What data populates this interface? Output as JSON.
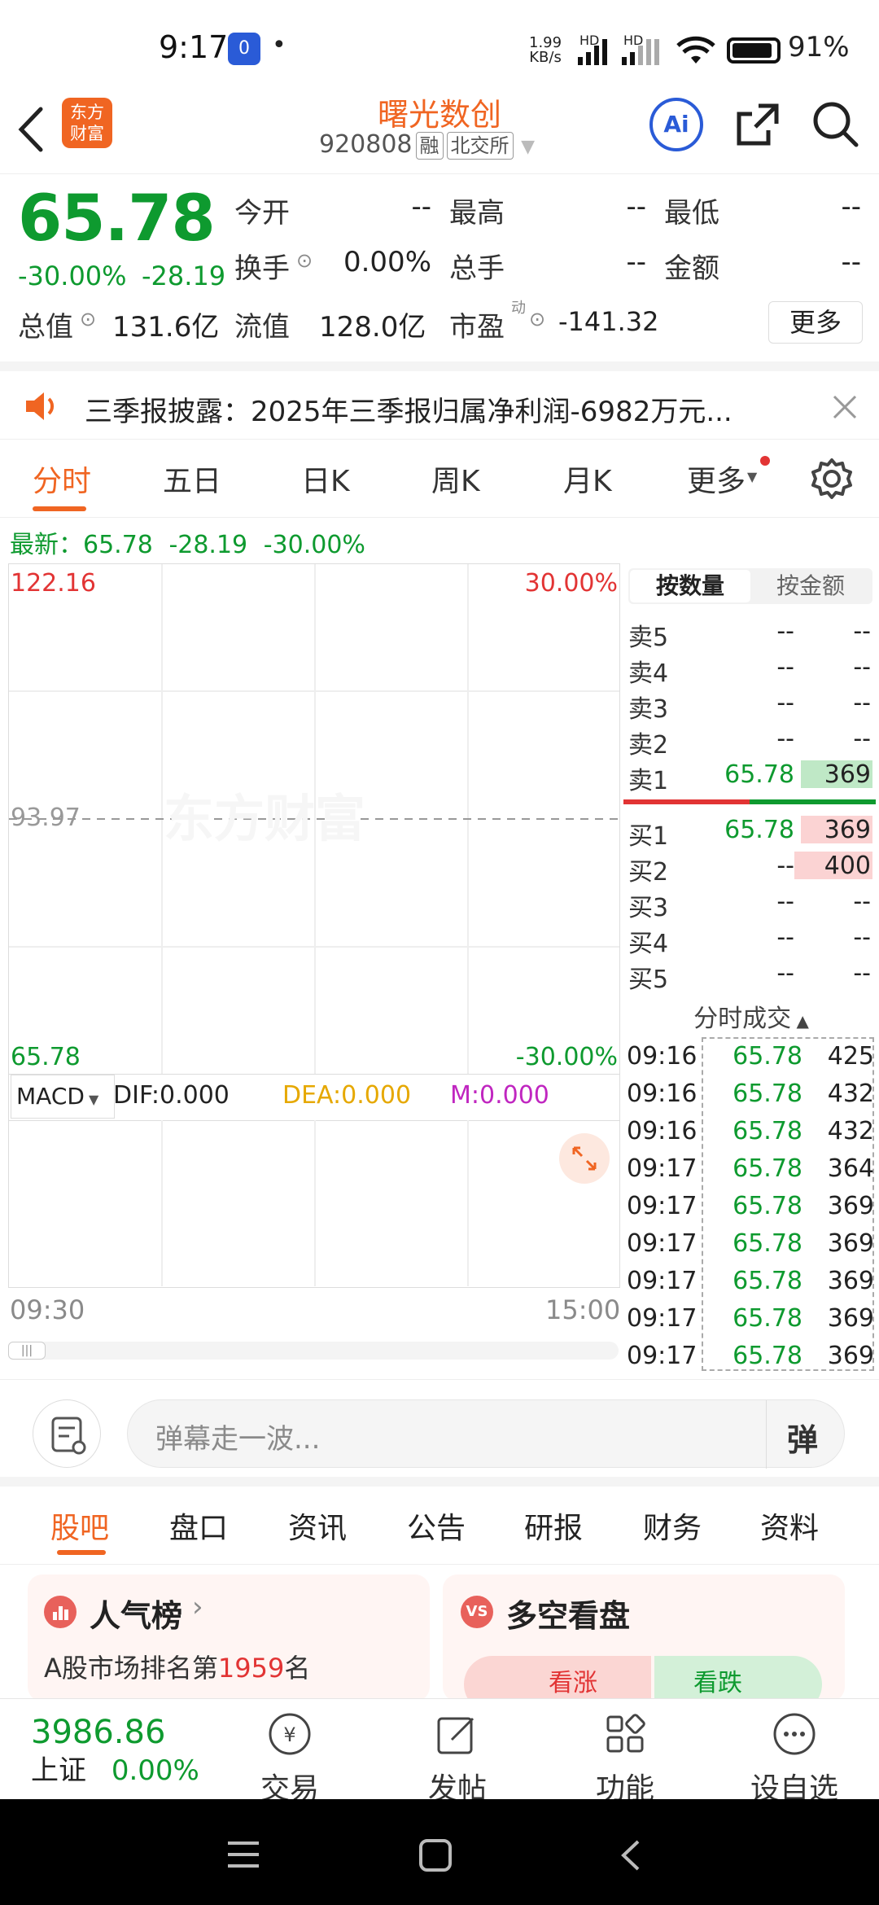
{
  "status_bar": {
    "time": "9:17",
    "app_badge": "0",
    "dot": "•",
    "net_speed": "1.99",
    "net_unit": "KB/s",
    "hd1": "HD",
    "hd2": "HD",
    "battery": "91%"
  },
  "header": {
    "logo_line1": "东方",
    "logo_line2": "财富",
    "stock_name": "曙光数创",
    "code": "920808",
    "tag_margin": "融",
    "tag_exchange": "北交所",
    "ai_label": "Ai"
  },
  "quote": {
    "price": "65.78",
    "change_pct": "-30.00%",
    "change": "-28.19",
    "open_label": "今开",
    "open": "--",
    "high_label": "最高",
    "high": "--",
    "low_label": "最低",
    "low": "--",
    "turnover_label": "换手",
    "turnover": "0.00%",
    "vol_label": "总手",
    "vol": "--",
    "amount_label": "金额",
    "amount": "--",
    "mcap_label": "总值",
    "mcap": "131.6亿",
    "float_label": "流值",
    "float": "128.0亿",
    "pe_label": "市盈",
    "pe_sup": "动",
    "pe": "-141.32",
    "more_button": "更多"
  },
  "notice": {
    "text": "三季报披露：2025年三季报归属净利润-6982万元..."
  },
  "tabs": [
    "分时",
    "五日",
    "日K",
    "周K",
    "月K",
    "更多"
  ],
  "latest_line": {
    "label": "最新：",
    "price": "65.78",
    "change": "-28.19",
    "pct": "-30.00%"
  },
  "chart": {
    "y_top": "122.16",
    "y_mid": "93.97",
    "y_bottom": "65.78",
    "pct_top": "30.00%",
    "pct_bottom": "-30.00%",
    "watermark": "东方财富",
    "x_start": "09:30",
    "x_end": "15:00",
    "macd_selector": "MACD",
    "dif": "DIF:0.000",
    "dea": "DEA:0.000",
    "m": "M:0.000",
    "accent_red": "#e23434",
    "accent_green": "#0e9a2f"
  },
  "order_book": {
    "toggle_qty": "按数量",
    "toggle_amt": "按金额",
    "sells": [
      {
        "label": "卖5",
        "price": "--",
        "vol": "--"
      },
      {
        "label": "卖4",
        "price": "--",
        "vol": "--"
      },
      {
        "label": "卖3",
        "price": "--",
        "vol": "--"
      },
      {
        "label": "卖2",
        "price": "--",
        "vol": "--"
      },
      {
        "label": "卖1",
        "price": "65.78",
        "vol": "369"
      }
    ],
    "buys": [
      {
        "label": "买1",
        "price": "65.78",
        "vol": "369"
      },
      {
        "label": "买2",
        "price": "--",
        "vol": "400"
      },
      {
        "label": "买3",
        "price": "--",
        "vol": "--"
      },
      {
        "label": "买4",
        "price": "--",
        "vol": "--"
      },
      {
        "label": "买5",
        "price": "--",
        "vol": "--"
      }
    ],
    "ticks_title": "分时成交",
    "ticks": [
      {
        "time": "09:16",
        "price": "65.78",
        "vol": "425"
      },
      {
        "time": "09:16",
        "price": "65.78",
        "vol": "432"
      },
      {
        "time": "09:16",
        "price": "65.78",
        "vol": "432"
      },
      {
        "time": "09:17",
        "price": "65.78",
        "vol": "364"
      },
      {
        "time": "09:17",
        "price": "65.78",
        "vol": "369"
      },
      {
        "time": "09:17",
        "price": "65.78",
        "vol": "369"
      },
      {
        "time": "09:17",
        "price": "65.78",
        "vol": "369"
      },
      {
        "time": "09:17",
        "price": "65.78",
        "vol": "369"
      },
      {
        "time": "09:17",
        "price": "65.78",
        "vol": "369"
      }
    ]
  },
  "danmu": {
    "placeholder": "弹幕走一波...",
    "button": "弹"
  },
  "bottom_tabs": [
    "股吧",
    "盘口",
    "资讯",
    "公告",
    "研报",
    "财务",
    "资料"
  ],
  "cards": {
    "popularity_title": "人气榜",
    "popularity_prefix": "A股市场排名第",
    "popularity_rank": "1959",
    "popularity_suffix": "名",
    "bullbear_badge": "VS",
    "bullbear_title": "多空看盘",
    "bull": "看涨",
    "bear": "看跌"
  },
  "bottom_nav": {
    "index_value": "3986.86",
    "index_name": "上证",
    "index_pct": "0.00%",
    "items": [
      "交易",
      "发帖",
      "功能",
      "设自选"
    ]
  }
}
